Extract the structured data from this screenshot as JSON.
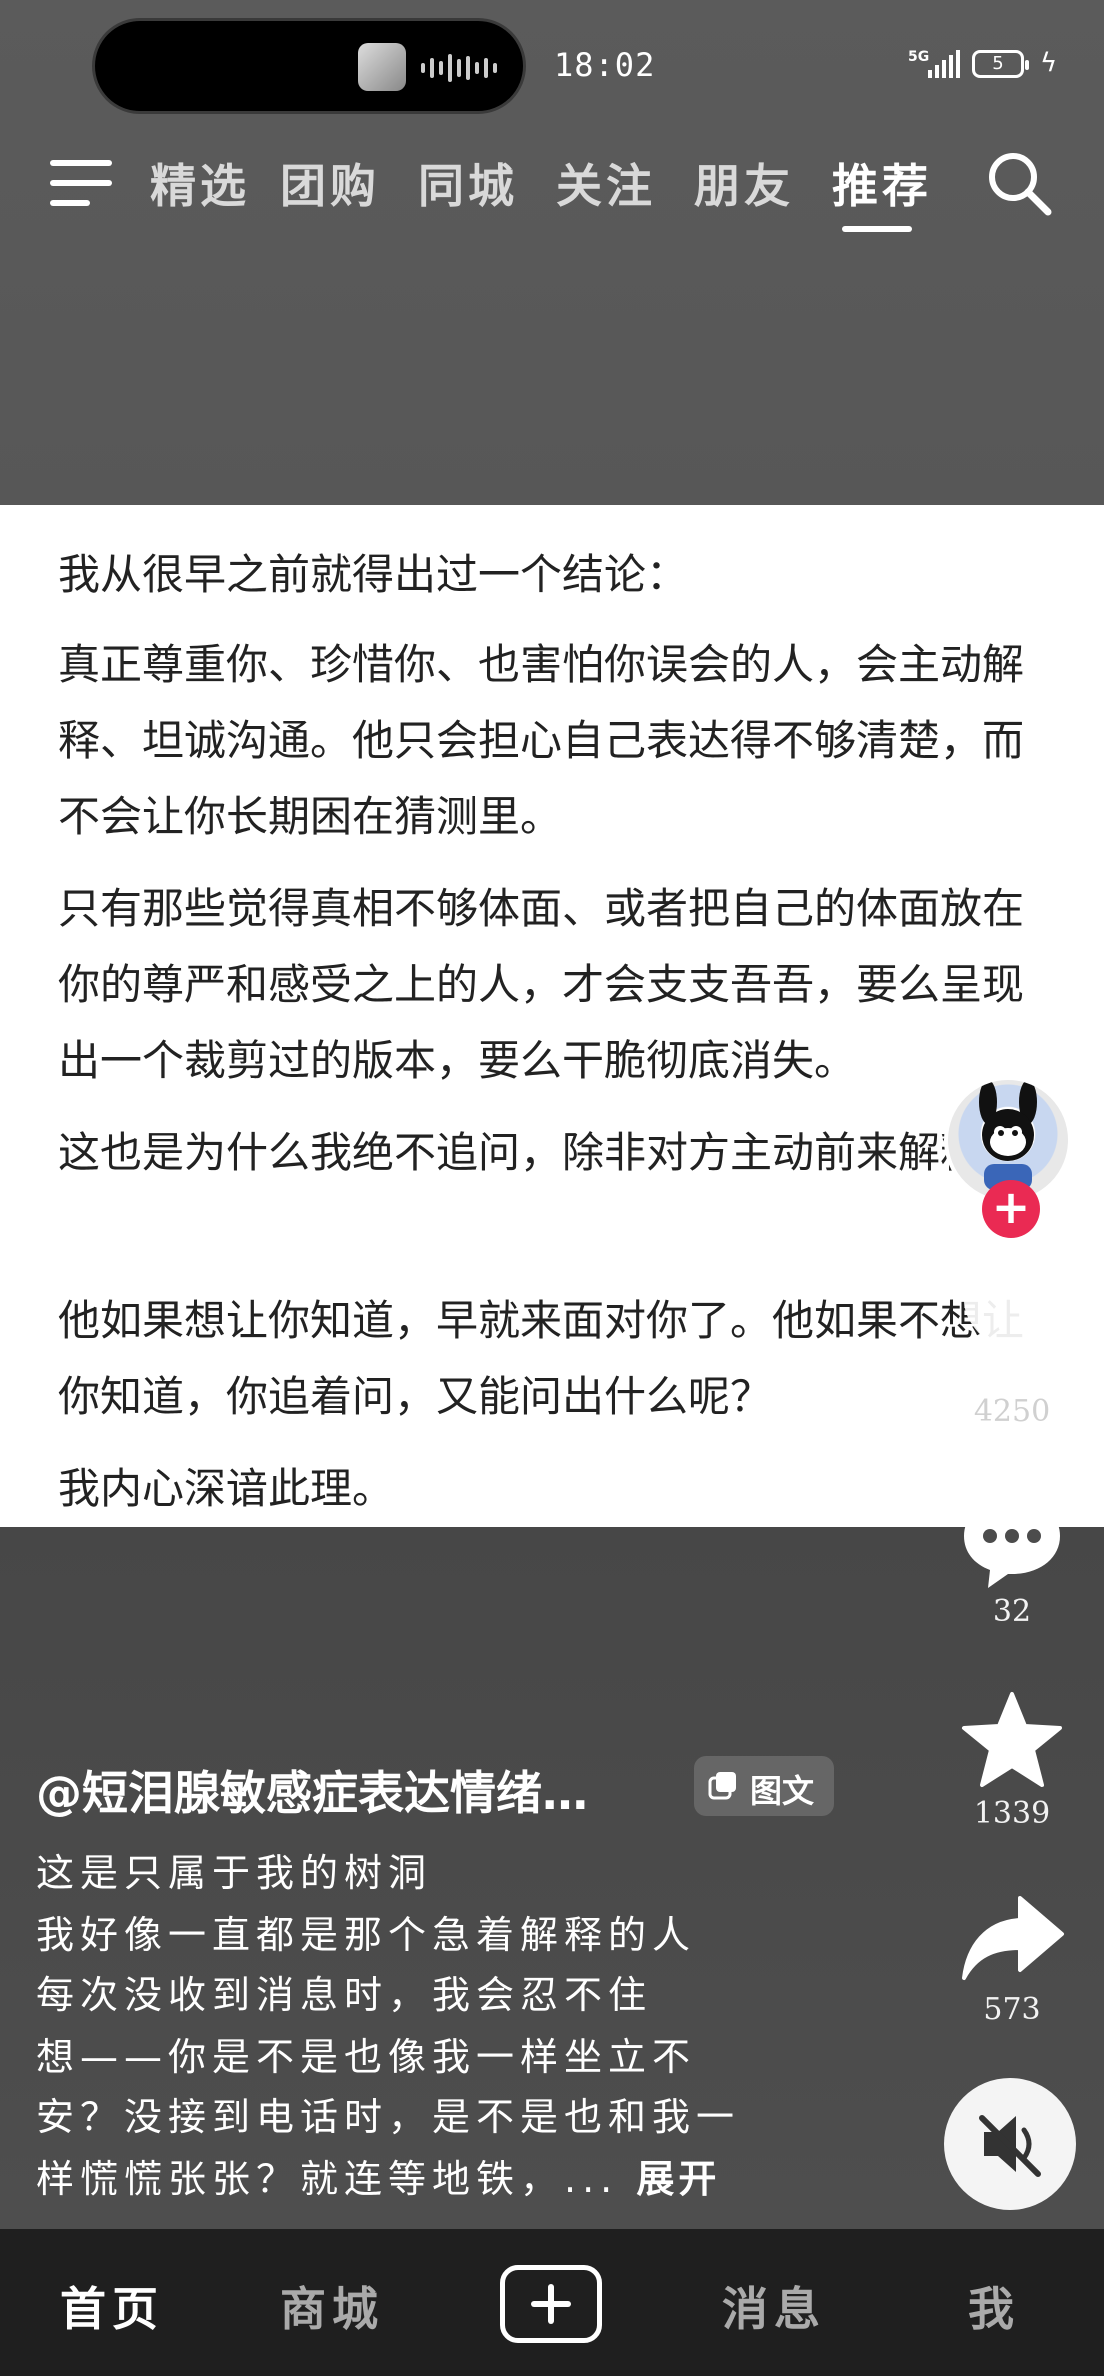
{
  "status_bar": {
    "time": "18:02",
    "network": "5G",
    "battery": "5"
  },
  "top_nav": {
    "tabs": [
      {
        "label": "精选"
      },
      {
        "label": "团购"
      },
      {
        "label": "同城"
      },
      {
        "label": "关注"
      },
      {
        "label": "朋友"
      },
      {
        "label": "推荐",
        "active": true
      }
    ]
  },
  "post": {
    "paragraphs": [
      "我从很早之前就得出过一个结论：",
      "真正尊重你、珍惜你、也害怕你误会的人，会主动解释、坦诚沟通。他只会担心自己表达得不够清楚，而不会让你长期困在猜测里。",
      "只有那些觉得真相不够体面、或者把自己的体面放在你的尊严和感受之上的人，才会支支吾吾，要么呈现出一个裁剪过的版本，要么干脆彻底消失。",
      "这也是为什么我绝不追问，除非对方主动前来解释。",
      "他如果想让你知道，早就来面对你了。他如果不想让你知道，你追着问，又能问出什么呢？",
      "我内心深谙此理。"
    ]
  },
  "actions": {
    "likes": "4250",
    "comments": "32",
    "favorites": "1339",
    "shares": "573"
  },
  "caption": {
    "author": "@短泪腺敏感症表达情绪…",
    "tag": "图文",
    "lines": [
      "这是只属于我的树洞",
      "我好像一直都是那个急着解释的人",
      "每次没收到消息时，我会忍不住",
      "想——你是不是也像我一样坐立不",
      "安？没接到电话时，是不是也和我一",
      "样慌慌张张？就连等地铁，..."
    ],
    "expand": "展开"
  },
  "bottom_nav": {
    "home": "首页",
    "mall": "商城",
    "messages": "消息",
    "me": "我"
  },
  "colors": {
    "follow_plus": "#ea2a53",
    "bottom_nav_bg": "#1f1f1f",
    "card_bg": "#ffffff"
  }
}
